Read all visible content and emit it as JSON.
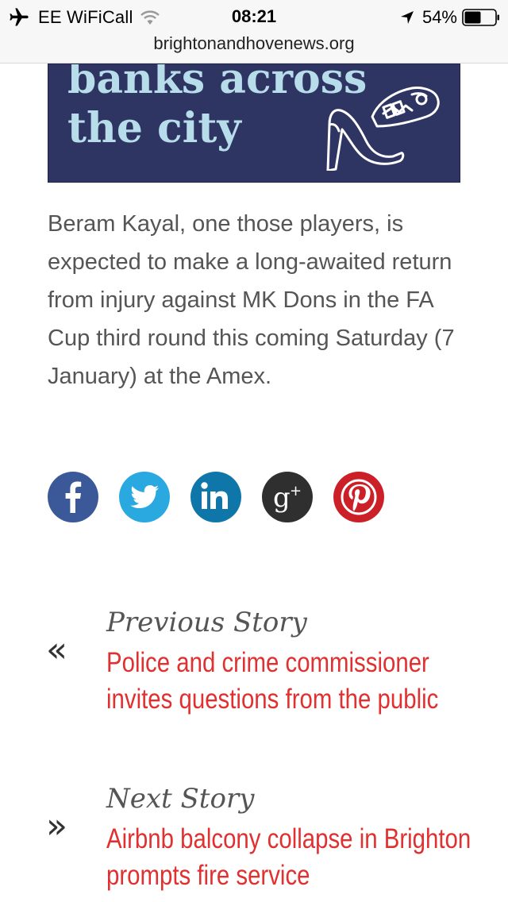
{
  "status_bar": {
    "carrier": "EE WiFiCall",
    "time": "08:21",
    "battery": "54%",
    "battery_level": 0.54,
    "url": "brightonandhovenews.org"
  },
  "banner": {
    "text": "banks across\nthe city",
    "icon": "high-heel-and-trainer-icon"
  },
  "article": {
    "paragraph": "Beram Kayal, one those players, is expected to make a long-awaited return from injury against MK Dons in the FA Cup third round this coming Saturday (7 January) at the Amex."
  },
  "share": [
    {
      "icon": "facebook-icon",
      "color": "#3b5998"
    },
    {
      "icon": "twitter-icon",
      "color": "#2aa9e0"
    },
    {
      "icon": "linkedin-icon",
      "color": "#0e76a8"
    },
    {
      "icon": "google-plus-icon",
      "color": "#2f2f2f"
    },
    {
      "icon": "pinterest-icon",
      "color": "#cb2027"
    }
  ],
  "navigation": {
    "previous_label": "Previous Story",
    "previous_title": "Police and crime commissioner invites questions from the public",
    "previous_arrow": "«",
    "next_label": "Next Story",
    "next_title": "Airbnb balcony collapse in Brighton prompts fire service",
    "next_arrow": "»"
  },
  "colors": {
    "link": "#e03030",
    "body_text": "#555555",
    "banner_bg": "#2f3562",
    "banner_text": "#b7ddea"
  }
}
